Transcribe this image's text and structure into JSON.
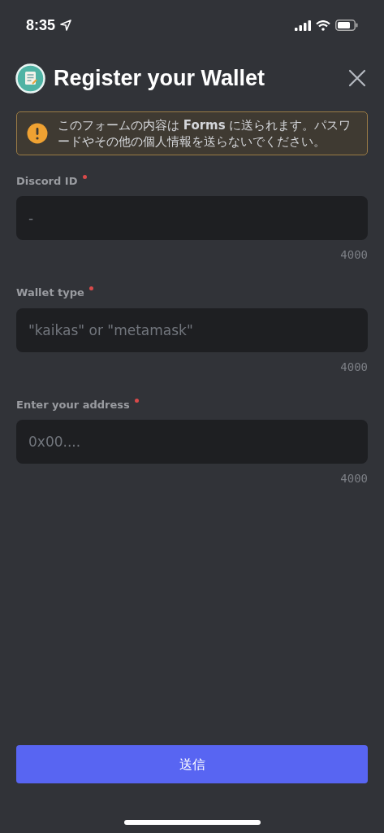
{
  "status_bar": {
    "time": "8:35"
  },
  "header": {
    "title": "Register your Wallet"
  },
  "notice": {
    "text": "このフォームの内容は **Forms** に送られます。パスワードやその他の個人情報を送らないでください。"
  },
  "fields": [
    {
      "label": "Discord ID",
      "required": true,
      "placeholder": "-",
      "counter": "4000"
    },
    {
      "label": "Wallet type",
      "required": true,
      "placeholder": "\"kaikas\" or \"metamask\"",
      "counter": "4000"
    },
    {
      "label": "Enter your address",
      "required": true,
      "placeholder": "0x00....",
      "counter": "4000"
    }
  ],
  "submit": {
    "label": "送信"
  }
}
